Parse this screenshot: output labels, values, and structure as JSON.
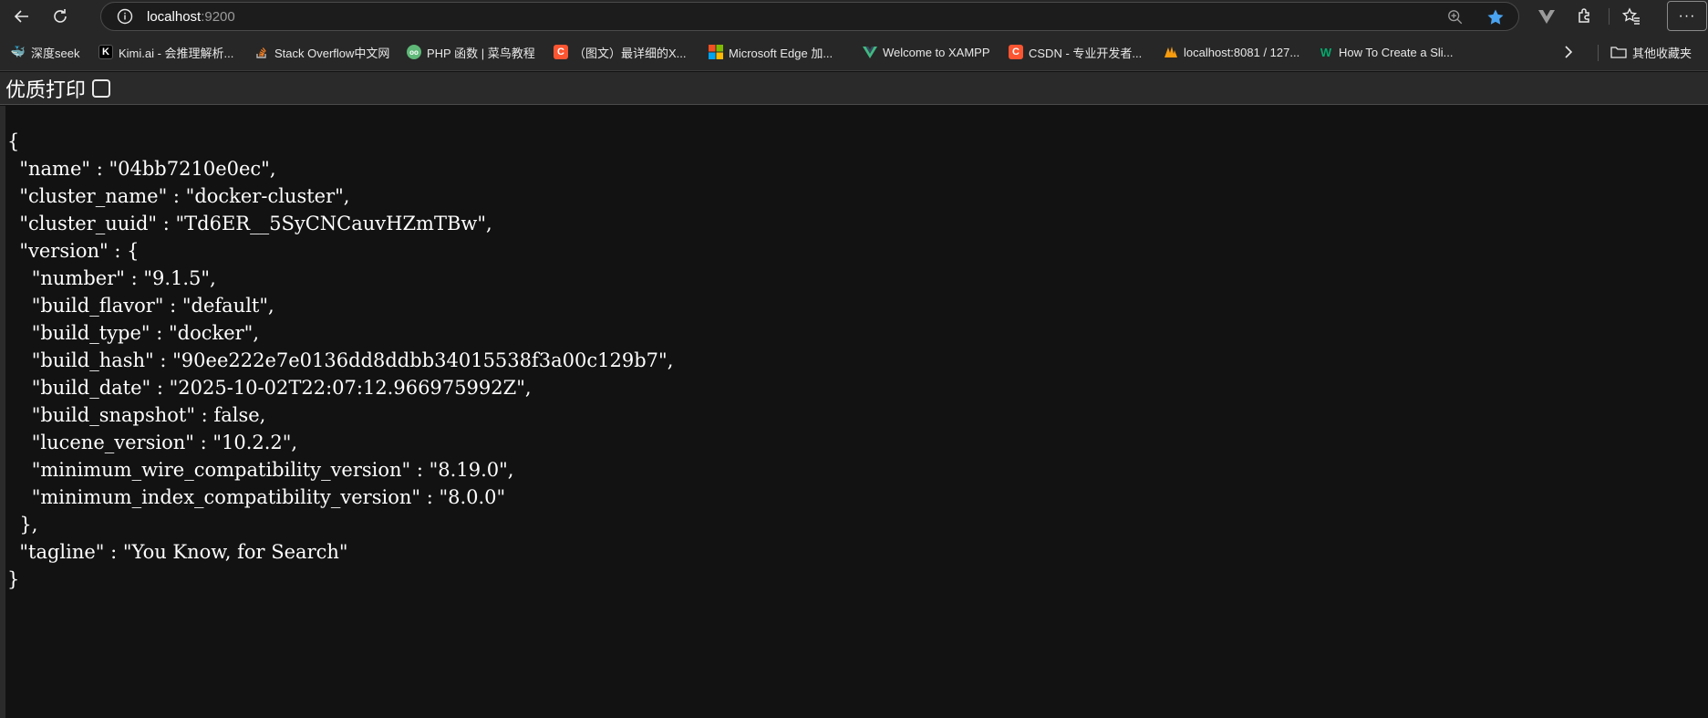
{
  "browser": {
    "url_host": "localhost",
    "url_port": ":9200",
    "more_label": "···"
  },
  "bookmarks": [
    {
      "label": "深度seek",
      "icon": "deepseek-icon",
      "color": "#4d6bfe"
    },
    {
      "label": "Kimi.ai - 会推理解析...",
      "icon": "kimi-icon",
      "color": "#000000"
    },
    {
      "label": "Stack Overflow中文网",
      "icon": "stackoverflow-icon",
      "color": "#f48024"
    },
    {
      "label": "PHP 函数 | 菜鸟教程",
      "icon": "runoob-icon",
      "color": "#5fb878"
    },
    {
      "label": "（图文）最详细的X...",
      "icon": "csdn-icon",
      "color": "#fc5531"
    },
    {
      "label": "Microsoft Edge 加...",
      "icon": "microsoft-icon",
      "color": "#f25022"
    },
    {
      "label": "Welcome to XAMPP",
      "icon": "vue-icon",
      "color": "#42b883"
    },
    {
      "label": "CSDN - 专业开发者...",
      "icon": "csdn-icon",
      "color": "#fc5531"
    },
    {
      "label": "localhost:8081 / 127...",
      "icon": "phpmyadmin-icon",
      "color": "#f89c0e"
    },
    {
      "label": "How To Create a Sli...",
      "icon": "w3schools-icon",
      "color": "#04aa6d"
    }
  ],
  "other_bookmarks_label": "其他收藏夹",
  "pretty_print": {
    "label": "优质打印",
    "checked": false
  },
  "json_lines": [
    "{",
    "  \"name\" : \"04bb7210e0ec\",",
    "  \"cluster_name\" : \"docker-cluster\",",
    "  \"cluster_uuid\" : \"Td6ER__5SyCNCauvHZmTBw\",",
    "  \"version\" : {",
    "    \"number\" : \"9.1.5\",",
    "    \"build_flavor\" : \"default\",",
    "    \"build_type\" : \"docker\",",
    "    \"build_hash\" : \"90ee222e7e0136dd8ddbb34015538f3a00c129b7\",",
    "    \"build_date\" : \"2025-10-02T22:07:12.966975992Z\",",
    "    \"build_snapshot\" : false,",
    "    \"lucene_version\" : \"10.2.2\",",
    "    \"minimum_wire_compatibility_version\" : \"8.19.0\",",
    "    \"minimum_index_compatibility_version\" : \"8.0.0\"",
    "  },",
    "  \"tagline\" : \"You Know, for Search\"",
    "}"
  ]
}
